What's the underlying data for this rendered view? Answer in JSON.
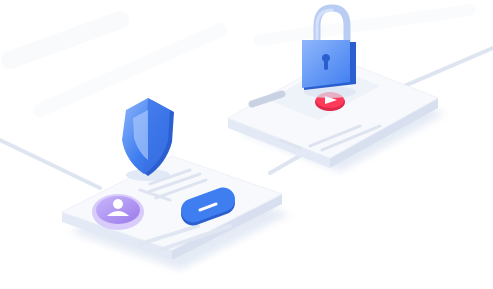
{
  "scene": {
    "description_text": "",
    "colors": {
      "background": "#ffffff",
      "card_top": "#f7f9fd",
      "card_side": "#e7ecf6",
      "line": "#dfe5f0",
      "blue": "#3f7ef0",
      "blue_dark": "#2b5fd0",
      "blue_light": "#8fb6fb",
      "purple": "#a98af0",
      "red": "#ff3b5c"
    },
    "icons": {
      "shield": "shield-icon",
      "lock": "lock-icon",
      "user": "user-avatar-icon",
      "play": "play-icon"
    },
    "button_label": ""
  }
}
